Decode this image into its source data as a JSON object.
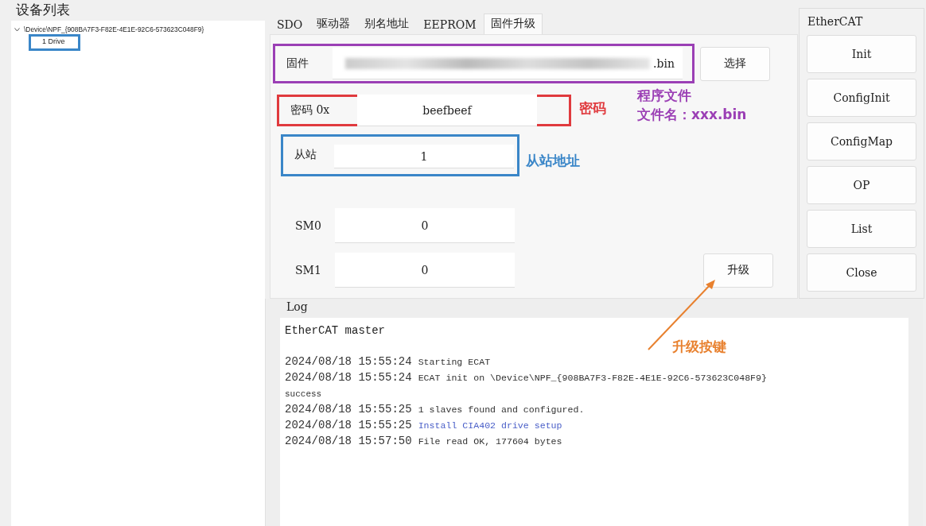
{
  "device_list": {
    "title": "设备列表",
    "tree": [
      {
        "label": "\\Device\\NPF_{908BA7F3-F82E-4E1E-92C6-573623C048F9}",
        "expanded": true,
        "children": [
          {
            "label": "1 Drive",
            "color": "#3a86c8"
          }
        ]
      }
    ]
  },
  "tabs": [
    {
      "label": "SDO",
      "selected": false
    },
    {
      "label": "驱动器",
      "selected": false
    },
    {
      "label": "别名地址",
      "selected": false
    },
    {
      "label": "EEPROM",
      "selected": false
    },
    {
      "label": "固件升级",
      "selected": true
    }
  ],
  "form": {
    "firmware": {
      "label": "固件",
      "value_tail": ".bin",
      "button": "选择",
      "color": "#9b3fb5"
    },
    "password": {
      "label": "密码 0x",
      "value": "beefbeef",
      "color": "#e03a3e"
    },
    "slave": {
      "label": "从站",
      "value": "1",
      "color": "#3a86c8"
    },
    "sm": [
      {
        "label": "SM0",
        "value": "0"
      },
      {
        "label": "SM1",
        "value": "0"
      }
    ],
    "upgrade_button": "升级"
  },
  "notes": [
    {
      "kind": "text",
      "lines": [
        "密码"
      ],
      "color": "#e03a3e"
    },
    {
      "kind": "text",
      "lines": [
        "程序文件",
        "文件名：xxx.bin"
      ],
      "color": "#9b3fb5"
    },
    {
      "kind": "text",
      "lines": [
        "从站地址"
      ],
      "color": "#3a86c8"
    },
    {
      "kind": "arrow",
      "lines": [
        "升级按键"
      ],
      "color": "#e8812f"
    }
  ],
  "ethercat": {
    "title": "EtherCAT",
    "buttons": [
      "Init",
      "ConfigInit",
      "ConfigMap",
      "OP",
      "List",
      "Close"
    ]
  },
  "log": {
    "title": "Log",
    "lines": [
      {
        "kind": "header",
        "text": "EtherCAT master"
      },
      {
        "kind": "entry",
        "time": "2024/08/18 15:55:24",
        "text": "Starting ECAT"
      },
      {
        "kind": "entry",
        "time": "2024/08/18 15:55:24",
        "text": "ECAT init on \\Device\\NPF_{908BA7F3-F82E-4E1E-92C6-573623C048F9}"
      },
      {
        "kind": "continuation",
        "text": "success"
      },
      {
        "kind": "entry",
        "time": "2024/08/18 15:55:25",
        "text": "1 slaves found and configured."
      },
      {
        "kind": "highlight",
        "time": "2024/08/18 15:55:25",
        "text": "Install CIA402 drive setup"
      },
      {
        "kind": "entry",
        "time": "2024/08/18 15:57:50",
        "text": "File read OK, 177604 bytes"
      }
    ]
  }
}
